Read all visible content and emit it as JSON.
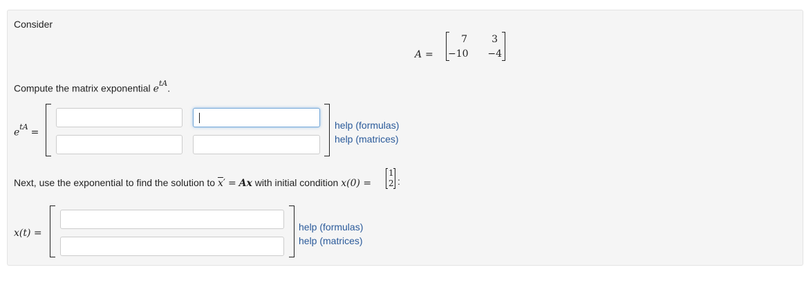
{
  "problem": {
    "consider_label": "Consider",
    "matrix_A": {
      "symbol": "A",
      "equals": "=",
      "rows": [
        [
          "7",
          "3"
        ],
        [
          "−10",
          "−4"
        ]
      ]
    },
    "compute_prompt": "Compute the matrix exponential",
    "compute_expr_base": "e",
    "compute_expr_sup": "tA",
    "compute_period": ".",
    "etA_label_base": "e",
    "etA_label_sup": "tA",
    "etA_equals": "=",
    "etA_inputs": [
      [
        "",
        ""
      ],
      [
        "",
        ""
      ]
    ],
    "help_formulas": "help (formulas)",
    "help_matrices": "help (matrices)",
    "next_prompt_pre": "Next, use the exponential to find the solution to",
    "next_xprime": "x",
    "next_prime": "′",
    "next_eq": "=",
    "next_Ax": "Ax",
    "next_with": "with initial condition",
    "next_x0": "x(0) =",
    "initial_vector": [
      "1",
      "2"
    ],
    "next_end": ":",
    "xt_label": "x(t) =",
    "xt_inputs": [
      "",
      ""
    ],
    "help2_formulas": "help (formulas)",
    "help2_matrices": "help (matrices)"
  }
}
